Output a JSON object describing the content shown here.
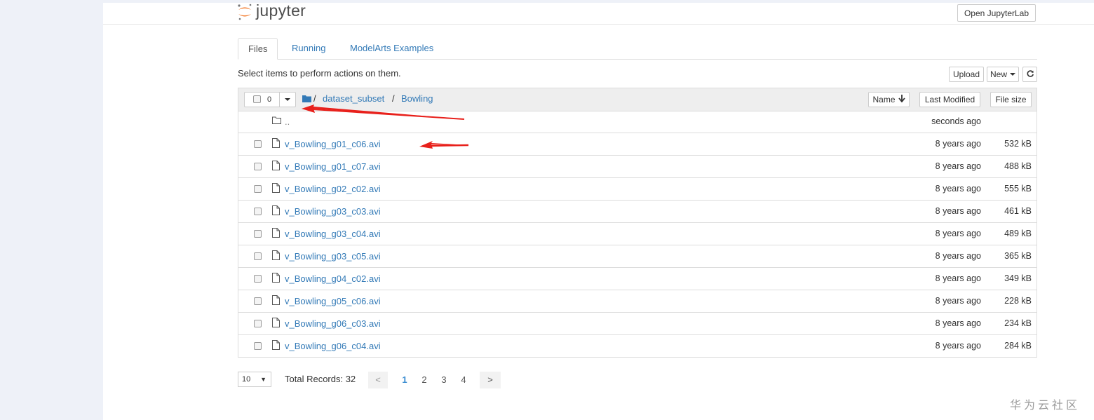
{
  "header": {
    "logo_text": "jupyter",
    "open_lab_label": "Open JupyterLab"
  },
  "tabs": [
    {
      "label": "Files"
    },
    {
      "label": "Running"
    },
    {
      "label": "ModelArts Examples"
    }
  ],
  "toolbar": {
    "instructions": "Select items to perform actions on them.",
    "upload_label": "Upload",
    "new_label": "New",
    "refresh_icon": "refresh-icon"
  },
  "list_header": {
    "selected_count": "0",
    "breadcrumb": [
      {
        "label": "/",
        "link": false
      },
      {
        "label": "dataset_subset",
        "link": true
      },
      {
        "label": "/",
        "link": false
      },
      {
        "label": "Bowling",
        "link": true
      }
    ],
    "sort_name_label": "Name",
    "last_modified_label": "Last Modified",
    "file_size_label": "File size"
  },
  "rows": [
    {
      "name": "..",
      "modified": "seconds ago",
      "size": "",
      "type": "folder"
    },
    {
      "name": "v_Bowling_g01_c06.avi",
      "modified": "8 years ago",
      "size": "532 kB",
      "type": "file"
    },
    {
      "name": "v_Bowling_g01_c07.avi",
      "modified": "8 years ago",
      "size": "488 kB",
      "type": "file"
    },
    {
      "name": "v_Bowling_g02_c02.avi",
      "modified": "8 years ago",
      "size": "555 kB",
      "type": "file"
    },
    {
      "name": "v_Bowling_g03_c03.avi",
      "modified": "8 years ago",
      "size": "461 kB",
      "type": "file"
    },
    {
      "name": "v_Bowling_g03_c04.avi",
      "modified": "8 years ago",
      "size": "489 kB",
      "type": "file"
    },
    {
      "name": "v_Bowling_g03_c05.avi",
      "modified": "8 years ago",
      "size": "365 kB",
      "type": "file"
    },
    {
      "name": "v_Bowling_g04_c02.avi",
      "modified": "8 years ago",
      "size": "349 kB",
      "type": "file"
    },
    {
      "name": "v_Bowling_g05_c06.avi",
      "modified": "8 years ago",
      "size": "228 kB",
      "type": "file"
    },
    {
      "name": "v_Bowling_g06_c03.avi",
      "modified": "8 years ago",
      "size": "234 kB",
      "type": "file"
    },
    {
      "name": "v_Bowling_g06_c04.avi",
      "modified": "8 years ago",
      "size": "284 kB",
      "type": "file"
    }
  ],
  "pagination": {
    "page_size": "10",
    "total_records": "Total Records: 32",
    "prev": "<",
    "pages": [
      "1",
      "2",
      "3",
      "4"
    ],
    "current_page": "1",
    "next": ">"
  },
  "watermark": "华为云社区",
  "colors": {
    "link": "#337ab7",
    "logo_orange": "#f37726",
    "annotation_arrow": "#e8201b",
    "gutter": "#eef1f8"
  }
}
